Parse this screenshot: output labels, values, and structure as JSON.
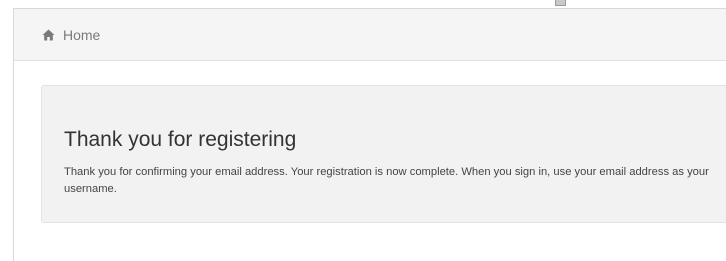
{
  "breadcrumb": {
    "home_label": "Home",
    "icon": "home-icon"
  },
  "confirmation": {
    "title": "Thank you for registering",
    "message": "Thank you for confirming your email address. Your registration is now complete. When you sign in, use your email address as your username."
  },
  "colors": {
    "breadcrumb_bg": "#f5f5f5",
    "panel_bg": "#f2f2f2",
    "breadcrumb_text": "#7a7a7a",
    "title_text": "#333333"
  }
}
